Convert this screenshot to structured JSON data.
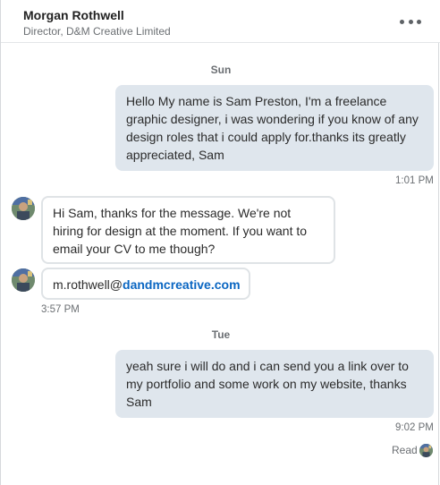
{
  "header": {
    "name": "Morgan Rothwell",
    "title": "Director, D&M Creative Limited",
    "more_icon": "more-horizontal-icon"
  },
  "days": [
    "Sun",
    "Tue"
  ],
  "messages": [
    {
      "direction": "outgoing",
      "text": "Hello My name is Sam Preston, I'm a freelance graphic designer, i was wondering if you know of any design roles that i could apply for.thanks its greatly appreciated, Sam",
      "time": "1:01 PM"
    },
    {
      "direction": "incoming",
      "text": "Hi Sam, thanks for the message. We're not hiring for design at the moment. If you want to email your CV to me though?"
    },
    {
      "direction": "incoming",
      "email_user": "m.rothwell@",
      "email_domain": "dandmcreative.com",
      "time": "3:57 PM"
    },
    {
      "direction": "outgoing",
      "text": "yeah sure i will do and i can send you a link over to my portfolio and some work on my website, thanks Sam",
      "time": "9:02 PM"
    }
  ],
  "read_receipt": "Read",
  "colors": {
    "outgoing_bubble": "#dfe6ed",
    "incoming_border": "#dfe3e6",
    "link": "#0a66c2",
    "muted_text": "#6b6f73"
  }
}
